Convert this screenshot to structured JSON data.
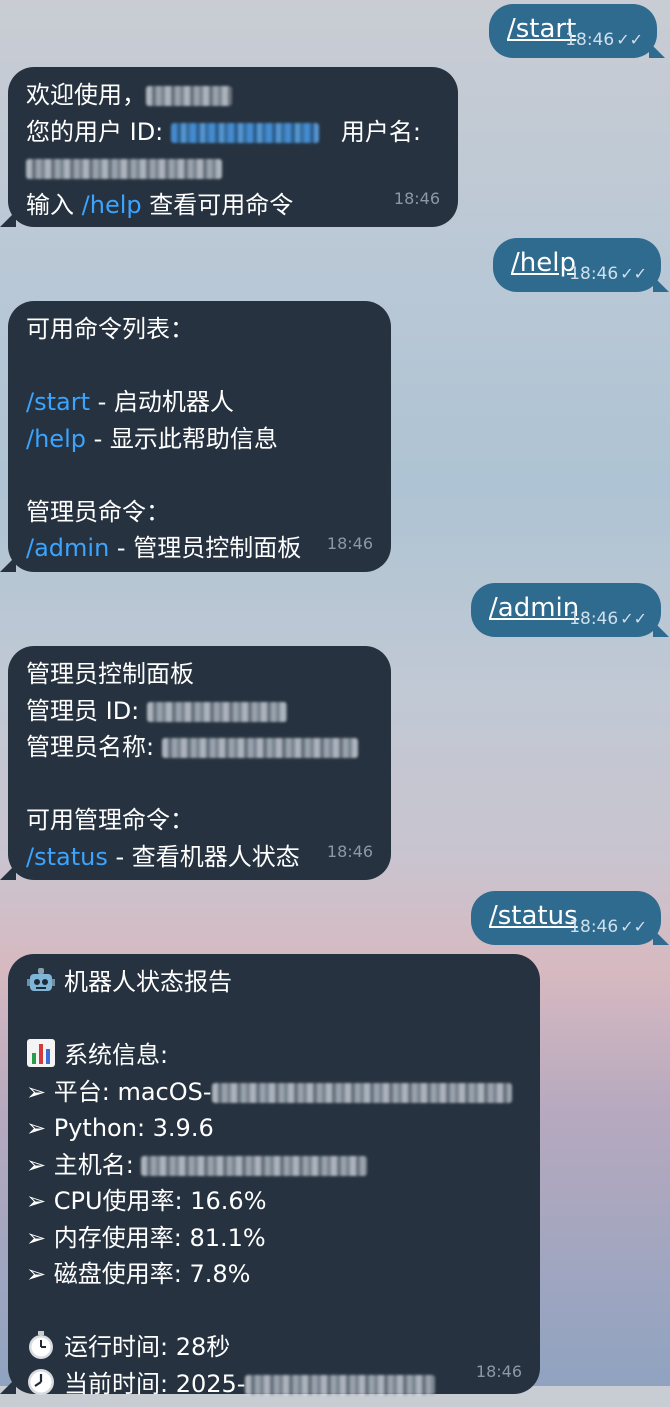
{
  "messages": {
    "m1": {
      "text": "/start",
      "time": "18:46",
      "ticks": "✓✓"
    },
    "m2": {
      "welcome": "欢迎使用，",
      "uid_label": "您的用户 ID: ",
      "uname_label": "用户名:",
      "help_prefix": "输入 ",
      "help_cmd": "/help",
      "help_suffix": " 查看可用命令",
      "time": "18:46"
    },
    "m3": {
      "text": "/help",
      "time": "18:46",
      "ticks": "✓✓"
    },
    "m4": {
      "title": "可用命令列表：",
      "c1_cmd": "/start",
      "c1_desc": " - 启动机器人",
      "c2_cmd": "/help",
      "c2_desc": " - 显示此帮助信息",
      "admin_title": "管理员命令：",
      "c3_cmd": "/admin",
      "c3_desc": " - 管理员控制面板",
      "time": "18:46"
    },
    "m5": {
      "text": "/admin",
      "time": "18:46",
      "ticks": "✓✓"
    },
    "m6": {
      "title": "管理员控制面板",
      "id_label": "管理员 ID: ",
      "name_label": "管理员名称: ",
      "cmds_title": "可用管理命令：",
      "c1_cmd": "/status",
      "c1_desc": " - 查看机器人状态",
      "time": "18:46"
    },
    "m7": {
      "text": "/status",
      "time": "18:46",
      "ticks": "✓✓"
    },
    "m8": {
      "title": "机器人状态报告",
      "sys_title": "系统信息:",
      "bullet": "➢",
      "platform": "平台: macOS-",
      "python": "Python: 3.9.6",
      "hostname": "主机名: ",
      "cpu": "CPU使用率: 16.6%",
      "mem": "内存使用率: 81.1%",
      "disk": "磁盘使用率: 7.8%",
      "uptime": "运行时间: 28秒",
      "now": "当前时间: 2025-",
      "time": "18:46"
    }
  },
  "icons": {
    "robot": "robot-icon",
    "chart": "bar-chart-icon",
    "stopwatch": "stopwatch-icon",
    "clock": "clock-icon"
  }
}
